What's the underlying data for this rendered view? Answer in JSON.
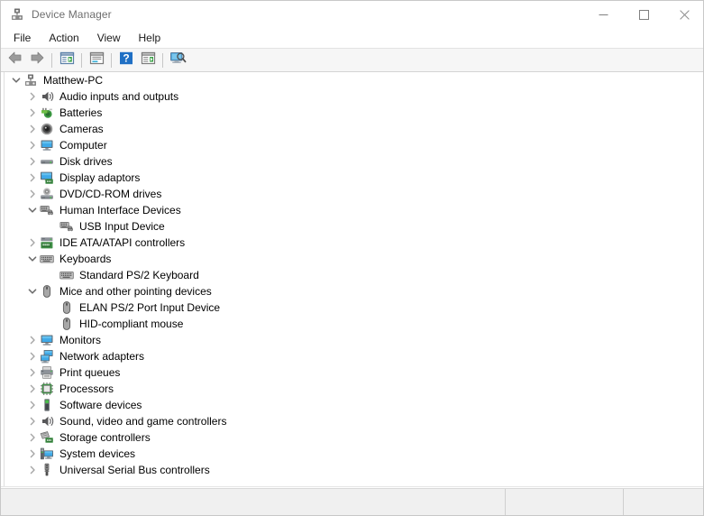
{
  "window": {
    "title": "Device Manager",
    "icon": "device-manager-icon",
    "controls": [
      {
        "name": "minimize-button",
        "glyph": "—"
      },
      {
        "name": "maximize-button",
        "glyph": "□"
      },
      {
        "name": "close-button",
        "glyph": "✕"
      }
    ]
  },
  "menubar": {
    "items": [
      {
        "label": "File",
        "name": "menu-file"
      },
      {
        "label": "Action",
        "name": "menu-action"
      },
      {
        "label": "View",
        "name": "menu-view"
      },
      {
        "label": "Help",
        "name": "menu-help"
      }
    ]
  },
  "toolbar": {
    "buttons": [
      {
        "name": "back-button",
        "icon": "back-arrow-icon",
        "tip": "Back"
      },
      {
        "name": "forward-button",
        "icon": "forward-arrow-icon",
        "tip": "Forward"
      },
      {
        "name": "show-hide-console-tree-button",
        "icon": "console-tree-icon",
        "tip": "Show/Hide Console Tree"
      },
      {
        "name": "properties-button",
        "icon": "properties-icon",
        "tip": "Properties"
      },
      {
        "name": "help-button",
        "icon": "help-question-icon",
        "tip": "Help"
      },
      {
        "name": "update-driver-button",
        "icon": "update-driver-icon",
        "tip": "Update driver"
      },
      {
        "name": "scan-for-hardware-changes-button",
        "icon": "scan-hardware-icon",
        "tip": "Scan for hardware changes"
      }
    ]
  },
  "tree": {
    "nodes": [
      {
        "label": "Matthew-PC",
        "level": 0,
        "state": "expanded",
        "icon": "computer-root-icon"
      },
      {
        "label": "Audio inputs and outputs",
        "level": 1,
        "state": "collapsed",
        "icon": "speaker-icon"
      },
      {
        "label": "Batteries",
        "level": 1,
        "state": "collapsed",
        "icon": "battery-icon"
      },
      {
        "label": "Cameras",
        "level": 1,
        "state": "collapsed",
        "icon": "camera-icon"
      },
      {
        "label": "Computer",
        "level": 1,
        "state": "collapsed",
        "icon": "monitor-icon"
      },
      {
        "label": "Disk drives",
        "level": 1,
        "state": "collapsed",
        "icon": "disk-drive-icon"
      },
      {
        "label": "Display adaptors",
        "level": 1,
        "state": "collapsed",
        "icon": "display-adapter-icon"
      },
      {
        "label": "DVD/CD-ROM drives",
        "level": 1,
        "state": "collapsed",
        "icon": "dvd-drive-icon"
      },
      {
        "label": "Human Interface Devices",
        "level": 1,
        "state": "expanded",
        "icon": "hid-icon"
      },
      {
        "label": "USB Input Device",
        "level": 2,
        "state": "leaf",
        "icon": "hid-icon"
      },
      {
        "label": "IDE ATA/ATAPI controllers",
        "level": 1,
        "state": "collapsed",
        "icon": "ide-controller-icon"
      },
      {
        "label": "Keyboards",
        "level": 1,
        "state": "expanded",
        "icon": "keyboard-icon"
      },
      {
        "label": "Standard PS/2 Keyboard",
        "level": 2,
        "state": "leaf",
        "icon": "keyboard-icon"
      },
      {
        "label": "Mice and other pointing devices",
        "level": 1,
        "state": "expanded",
        "icon": "mouse-icon"
      },
      {
        "label": "ELAN PS/2 Port Input Device",
        "level": 2,
        "state": "leaf",
        "icon": "mouse-icon"
      },
      {
        "label": "HID-compliant mouse",
        "level": 2,
        "state": "leaf",
        "icon": "mouse-icon"
      },
      {
        "label": "Monitors",
        "level": 1,
        "state": "collapsed",
        "icon": "monitor-icon"
      },
      {
        "label": "Network adapters",
        "level": 1,
        "state": "collapsed",
        "icon": "network-adapter-icon"
      },
      {
        "label": "Print queues",
        "level": 1,
        "state": "collapsed",
        "icon": "printer-icon"
      },
      {
        "label": "Processors",
        "level": 1,
        "state": "collapsed",
        "icon": "processor-icon"
      },
      {
        "label": "Software devices",
        "level": 1,
        "state": "collapsed",
        "icon": "software-device-icon"
      },
      {
        "label": "Sound, video and game controllers",
        "level": 1,
        "state": "collapsed",
        "icon": "speaker-icon"
      },
      {
        "label": "Storage controllers",
        "level": 1,
        "state": "collapsed",
        "icon": "storage-controller-icon"
      },
      {
        "label": "System devices",
        "level": 1,
        "state": "collapsed",
        "icon": "system-device-icon"
      },
      {
        "label": "Universal Serial Bus controllers",
        "level": 1,
        "state": "collapsed",
        "icon": "usb-controller-icon"
      }
    ]
  },
  "statusbar": {
    "panes": [
      "",
      "",
      ""
    ]
  },
  "colors": {
    "window_bg": "#ffffff",
    "toolbar_bg": "#f6f6f6",
    "status_bg": "#f0f0f0",
    "title_text": "#6e6e6e",
    "tree_text": "#000000",
    "chevron": "#9a9a9a",
    "accent_blue": "#0078d7"
  }
}
